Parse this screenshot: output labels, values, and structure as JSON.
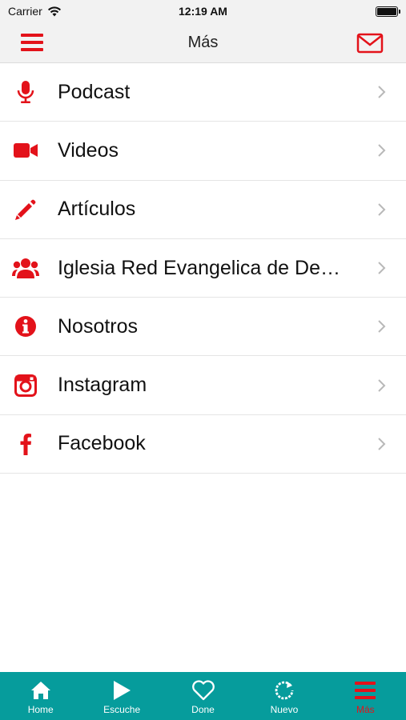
{
  "status_bar": {
    "carrier": "Carrier",
    "time": "12:19 AM"
  },
  "nav": {
    "title": "Más",
    "left_icon": "menu-icon",
    "right_icon": "mail-icon"
  },
  "menu_items": [
    {
      "label": "Podcast",
      "icon": "microphone-icon"
    },
    {
      "label": "Videos",
      "icon": "video-camera-icon"
    },
    {
      "label": "Artículos",
      "icon": "pencil-icon"
    },
    {
      "label": "Iglesia Red Evangelica de De…",
      "icon": "users-icon"
    },
    {
      "label": "Nosotros",
      "icon": "info-icon"
    },
    {
      "label": "Instagram",
      "icon": "instagram-icon"
    },
    {
      "label": "Facebook",
      "icon": "facebook-icon"
    }
  ],
  "tabs": [
    {
      "label": "Home",
      "icon": "home-icon"
    },
    {
      "label": "Escuche",
      "icon": "play-icon"
    },
    {
      "label": "Done",
      "icon": "heart-icon"
    },
    {
      "label": "Nuevo",
      "icon": "refresh-icon"
    },
    {
      "label": "Más",
      "icon": "menu-icon",
      "active": true
    }
  ],
  "colors": {
    "accent": "#e3121a",
    "tab_bar": "#069c9c",
    "nav_bg": "#f2f2f2"
  }
}
